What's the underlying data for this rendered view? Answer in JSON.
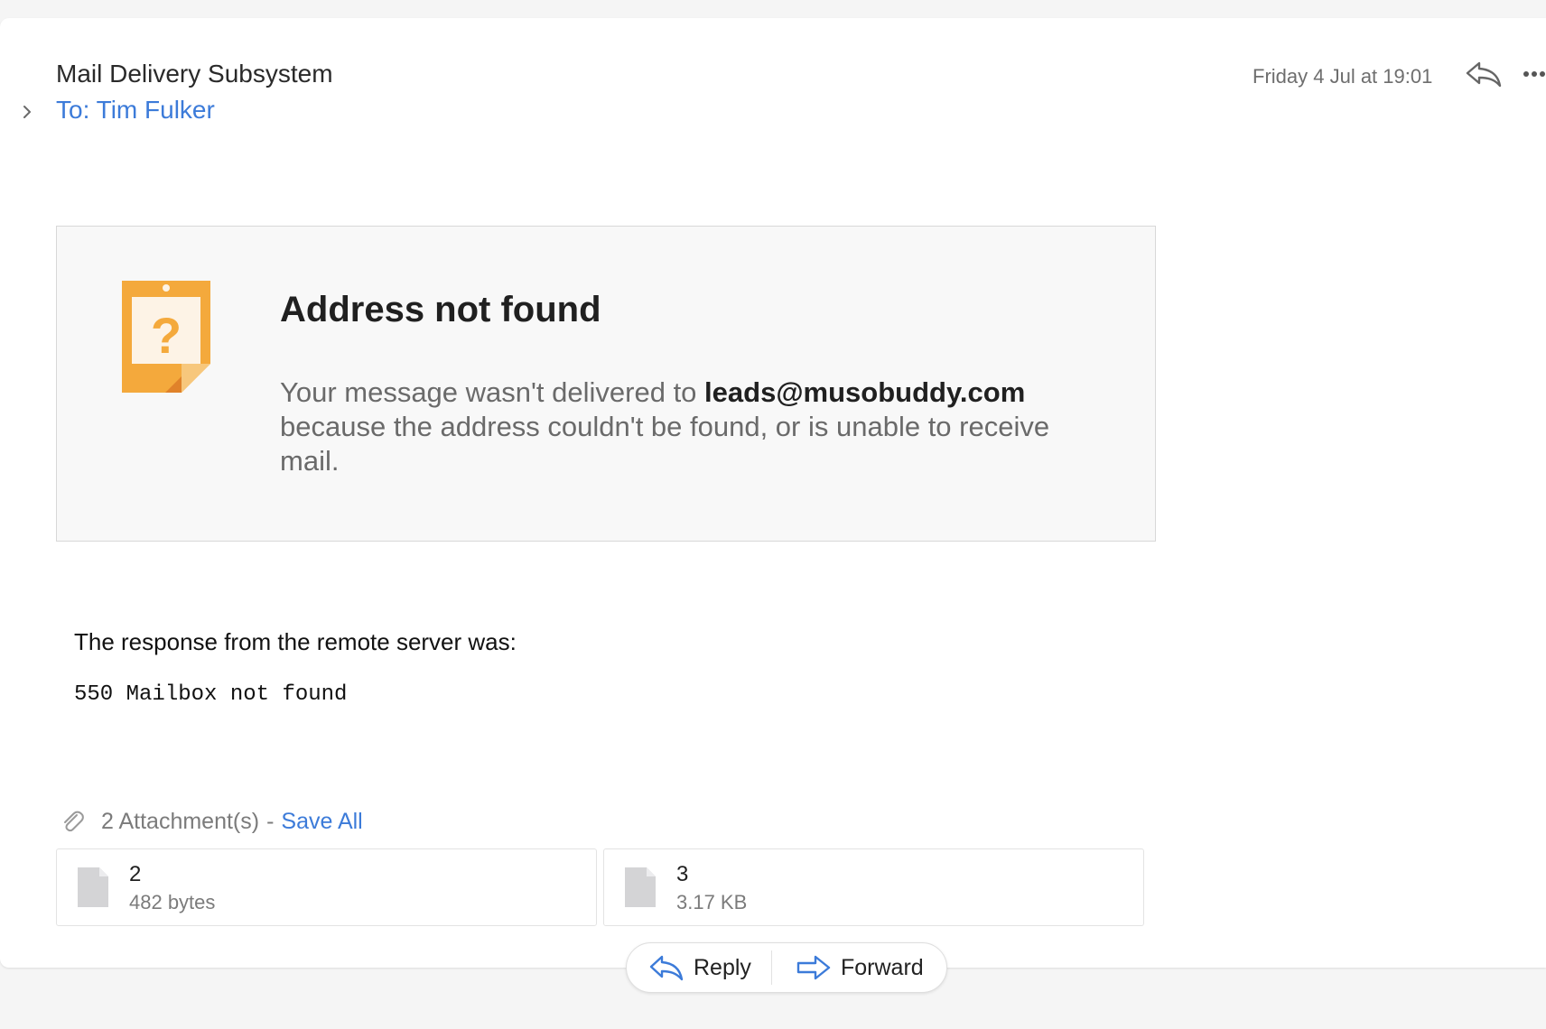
{
  "header": {
    "sender": "Mail Delivery Subsystem",
    "to_line": "To: Tim Fulker",
    "datetime": "Friday 4 Jul at 19:01"
  },
  "notice": {
    "title": "Address not found",
    "body_prefix": "Your message wasn't delivered to ",
    "address": "leads@musobuddy.com",
    "body_suffix": " because the address couldn't be found, or is unable to receive mail.",
    "accent_color": "#f4a93c"
  },
  "server": {
    "intro": "The response from the remote server was:",
    "code": "550 Mailbox not found"
  },
  "attachments": {
    "count_label": "2 Attachment(s)",
    "separator": "-",
    "save_all_label": "Save All",
    "items": [
      {
        "name": "2",
        "size": "482 bytes"
      },
      {
        "name": "3",
        "size": "3.17 KB"
      }
    ]
  },
  "actions": {
    "reply_label": "Reply",
    "forward_label": "Forward"
  },
  "colors": {
    "link": "#3c7bd9",
    "icon_blue": "#3c7bd9"
  }
}
